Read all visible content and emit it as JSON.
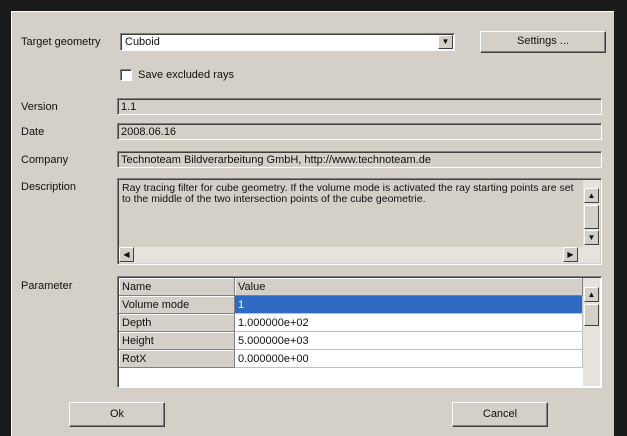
{
  "labels": {
    "target_geometry": "Target geometry",
    "version": "Version",
    "date": "Date",
    "company": "Company",
    "description": "Description",
    "parameter": "Parameter"
  },
  "target_geometry": {
    "selected": "Cuboid"
  },
  "settings_label": "Settings ...",
  "save_excluded_rays": {
    "label": "Save excluded rays",
    "checked": false
  },
  "version": "1.1",
  "date": "2008.06.16",
  "company": "Technoteam Bildverarbeitung GmbH, http://www.technoteam.de",
  "description": "Ray tracing filter for cube geometry. If the volume mode is activated the ray starting points are set to the middle of the two intersection points of the cube geometrie.",
  "parameter_table": {
    "columns": [
      "Name",
      "Value"
    ],
    "rows": [
      {
        "name": "Volume mode",
        "value": "1"
      },
      {
        "name": "Depth",
        "value": "1.000000e+02"
      },
      {
        "name": "Height",
        "value": "5.000000e+03"
      },
      {
        "name": "RotX",
        "value": "0.000000e+00"
      }
    ]
  },
  "ok_label": "Ok",
  "cancel_label": "Cancel",
  "icons": {
    "dropdown": "triangle-down",
    "scroll_up": "triangle-up",
    "scroll_down": "triangle-down",
    "scroll_left": "triangle-left",
    "scroll_right": "triangle-right"
  },
  "colors": {
    "selection": "#2f6bc4",
    "dialog_bg": "#d4d0c8"
  }
}
